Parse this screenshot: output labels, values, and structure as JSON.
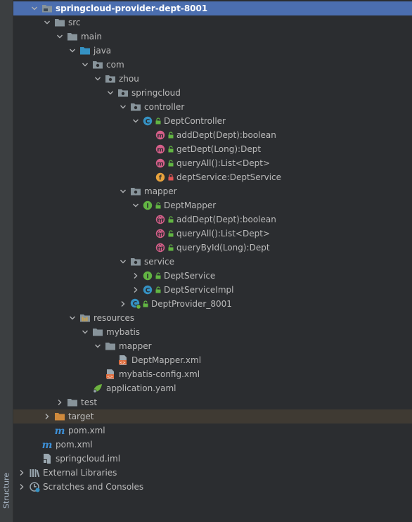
{
  "sidebar": {
    "label": "Structure"
  },
  "tree": [
    {
      "label": "springcloud-provider-dept-8001",
      "depth": 1,
      "expanded": true,
      "icon": "module-folder-icon",
      "selected": true,
      "bold": true
    },
    {
      "label": "src",
      "depth": 2,
      "expanded": true,
      "icon": "folder-icon"
    },
    {
      "label": "main",
      "depth": 3,
      "expanded": true,
      "icon": "folder-icon"
    },
    {
      "label": "java",
      "depth": 4,
      "expanded": true,
      "icon": "source-folder-icon"
    },
    {
      "label": "com",
      "depth": 5,
      "expanded": true,
      "icon": "package-icon"
    },
    {
      "label": "zhou",
      "depth": 6,
      "expanded": true,
      "icon": "package-icon"
    },
    {
      "label": "springcloud",
      "depth": 7,
      "expanded": true,
      "icon": "package-icon"
    },
    {
      "label": "controller",
      "depth": 8,
      "expanded": true,
      "icon": "package-icon"
    },
    {
      "label": "DeptController",
      "depth": 9,
      "expanded": true,
      "icon": "class-icon",
      "lock": "public-icon"
    },
    {
      "label": "addDept(Dept):boolean",
      "depth": 10,
      "icon": "method-icon",
      "lock": "public-icon"
    },
    {
      "label": "getDept(Long):Dept",
      "depth": 10,
      "icon": "method-icon",
      "lock": "public-icon"
    },
    {
      "label": "queryAll():List<Dept>",
      "depth": 10,
      "icon": "method-icon",
      "lock": "public-icon"
    },
    {
      "label": "deptService:DeptService",
      "depth": 10,
      "icon": "field-icon",
      "lock": "private-icon"
    },
    {
      "label": "mapper",
      "depth": 8,
      "expanded": true,
      "icon": "package-icon"
    },
    {
      "label": "DeptMapper",
      "depth": 9,
      "expanded": true,
      "icon": "interface-icon",
      "lock": "public-icon"
    },
    {
      "label": "addDept(Dept):boolean",
      "depth": 10,
      "icon": "abstract-method-icon",
      "lock": "public-icon"
    },
    {
      "label": "queryAll():List<Dept>",
      "depth": 10,
      "icon": "abstract-method-icon",
      "lock": "public-icon"
    },
    {
      "label": "queryById(Long):Dept",
      "depth": 10,
      "icon": "abstract-method-icon",
      "lock": "public-icon"
    },
    {
      "label": "service",
      "depth": 8,
      "expanded": true,
      "icon": "package-icon"
    },
    {
      "label": "DeptService",
      "depth": 9,
      "expanded": false,
      "icon": "interface-icon",
      "lock": "public-icon"
    },
    {
      "label": "DeptServiceImpl",
      "depth": 9,
      "expanded": false,
      "icon": "class-icon",
      "lock": "public-icon"
    },
    {
      "label": "DeptProvider_8001",
      "depth": 8,
      "expanded": false,
      "icon": "spring-boot-class-icon",
      "lock": "public-icon"
    },
    {
      "label": "resources",
      "depth": 4,
      "expanded": true,
      "icon": "resources-folder-icon"
    },
    {
      "label": "mybatis",
      "depth": 5,
      "expanded": true,
      "icon": "folder-icon"
    },
    {
      "label": "mapper",
      "depth": 6,
      "expanded": true,
      "icon": "folder-icon"
    },
    {
      "label": "DeptMapper.xml",
      "depth": 7,
      "icon": "xml-file-icon"
    },
    {
      "label": "mybatis-config.xml",
      "depth": 6,
      "icon": "xml-file-icon"
    },
    {
      "label": "application.yaml",
      "depth": 5,
      "icon": "spring-yaml-icon"
    },
    {
      "label": "test",
      "depth": 3,
      "expanded": false,
      "icon": "folder-icon"
    },
    {
      "label": "target",
      "depth": 2,
      "expanded": false,
      "icon": "excluded-folder-icon",
      "highlight": true
    },
    {
      "label": "pom.xml",
      "depth": 2,
      "icon": "maven-icon"
    },
    {
      "label": "pom.xml",
      "depth": 1,
      "icon": "maven-icon"
    },
    {
      "label": "springcloud.iml",
      "depth": 1,
      "icon": "iml-file-icon"
    },
    {
      "label": "External Libraries",
      "depth": 0,
      "expanded": false,
      "icon": "libraries-icon"
    },
    {
      "label": "Scratches and Consoles",
      "depth": 0,
      "expanded": false,
      "icon": "scratches-icon"
    }
  ]
}
